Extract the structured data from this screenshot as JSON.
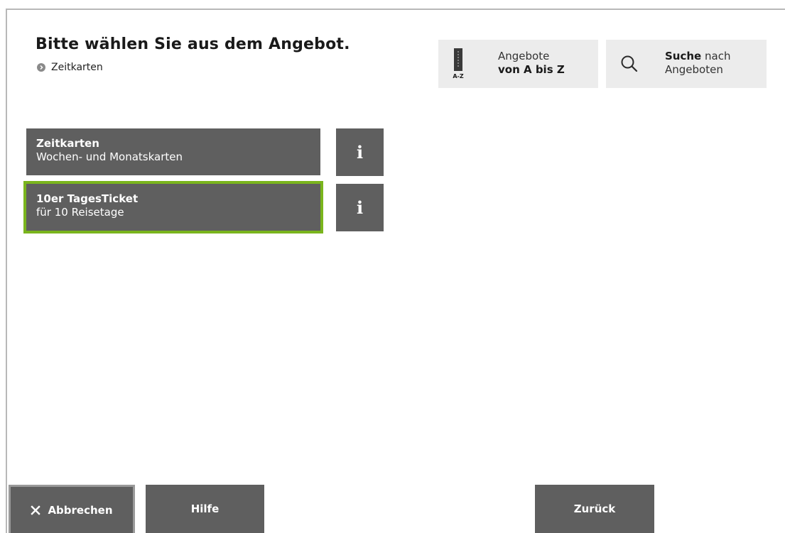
{
  "header": {
    "title": "Bitte wählen Sie aus dem Angebot.",
    "breadcrumb": "Zeitkarten"
  },
  "az_button": {
    "icon_text": "A-Z",
    "line1": "Angebote",
    "line2": "von A bis Z"
  },
  "search_button": {
    "bold": "Suche",
    "rest": " nach",
    "line2": "Angeboten"
  },
  "offers": [
    {
      "title": "Zeitkarten",
      "subtitle": "Wochen- und Monatskarten",
      "selected": false,
      "info": "i"
    },
    {
      "title": "10er TagesTicket",
      "subtitle": "für 10 Reisetage",
      "selected": true,
      "info": "i"
    }
  ],
  "footer": {
    "cancel_label": "Abbrechen",
    "help_label": "Hilfe",
    "back_label": "Zurück"
  },
  "colors": {
    "button_bg": "#5f5f5f",
    "selection_accent": "#7ab51d",
    "topbutton_bg": "#ececec"
  }
}
